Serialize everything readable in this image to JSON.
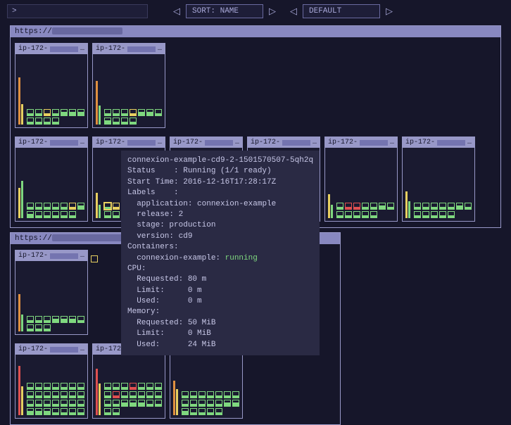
{
  "toolbar": {
    "prompt": ">",
    "search_value": "",
    "sort_label": "SORT: NAME",
    "filter_label": "DEFAULT"
  },
  "clusters": [
    {
      "url_prefix": "https://",
      "nodes": [
        {
          "hostname_prefix": "ip-172-"
        },
        {
          "hostname_prefix": "ip-172-"
        },
        {
          "hostname_prefix": "ip-172-"
        },
        {
          "hostname_prefix": "ip-172-"
        },
        {
          "hostname_prefix": "ip-172-"
        },
        {
          "hostname_prefix": "ip-172-"
        },
        {
          "hostname_prefix": "ip-172-"
        },
        {
          "hostname_prefix": "ip-172-"
        }
      ]
    },
    {
      "url_prefix": "https://",
      "nodes": [
        {
          "hostname_prefix": "ip-172-"
        },
        {
          "hostname_prefix": "ip-172-"
        },
        {
          "hostname_prefix": "ip-172-"
        },
        {
          "hostname_prefix": "ip-172-"
        }
      ]
    }
  ],
  "tooltip": {
    "pod_name": "connexion-example-cd9-2-1501570507-5qh2q",
    "status_label": "Status",
    "status_value": "Running (1/1 ready)",
    "start_label": "Start Time",
    "start_value": "2016-12-16T17:28:17Z",
    "labels_label": "Labels",
    "label_app_key": "application",
    "label_app_val": "connexion-example",
    "label_release_key": "release",
    "label_release_val": "2",
    "label_stage_key": "stage",
    "label_stage_val": "production",
    "label_version_key": "version",
    "label_version_val": "cd9",
    "containers_label": "Containers",
    "container_name": "connexion-example",
    "container_state": "running",
    "cpu_label": "CPU",
    "cpu_requested_label": "Requested",
    "cpu_requested_val": "80 m",
    "cpu_limit_label": "Limit",
    "cpu_limit_val": "0 m",
    "cpu_used_label": "Used",
    "cpu_used_val": "0 m",
    "mem_label": "Memory",
    "mem_requested_label": "Requested",
    "mem_requested_val": "50 MiB",
    "mem_limit_label": "Limit",
    "mem_limit_val": "0 MiB",
    "mem_used_label": "Used",
    "mem_used_val": "24 MiB"
  }
}
